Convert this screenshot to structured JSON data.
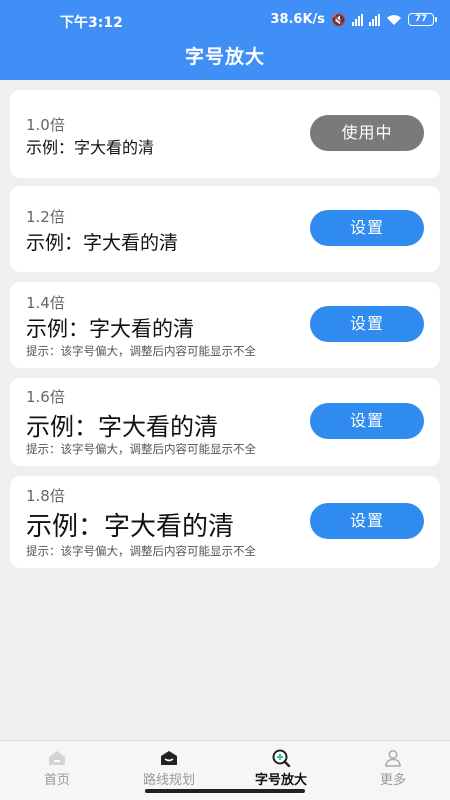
{
  "status": {
    "time": "下午3:12",
    "net_speed": "38.6K/s",
    "battery": "77"
  },
  "header": {
    "title": "字号放大"
  },
  "options": [
    {
      "scale": "1.0倍",
      "example": "示例：字大看的清",
      "hint": "",
      "button": "使用中",
      "active": true
    },
    {
      "scale": "1.2倍",
      "example": "示例：字大看的清",
      "hint": "",
      "button": "设置",
      "active": false
    },
    {
      "scale": "1.4倍",
      "example": "示例：字大看的清",
      "hint": "提示：该字号偏大，调整后内容可能显示不全",
      "button": "设置",
      "active": false
    },
    {
      "scale": "1.6倍",
      "example": "示例：字大看的清",
      "hint": "提示：该字号偏大，调整后内容可能显示不全",
      "button": "设置",
      "active": false
    },
    {
      "scale": "1.8倍",
      "example": "示例：字大看的清",
      "hint": "提示：该字号偏大，调整后内容可能显示不全",
      "button": "设置",
      "active": false
    }
  ],
  "tabbar": {
    "items": [
      {
        "label": "首页",
        "icon": "home-icon"
      },
      {
        "label": "路线规划",
        "icon": "route-icon"
      },
      {
        "label": "字号放大",
        "icon": "zoom-icon"
      },
      {
        "label": "更多",
        "icon": "user-icon"
      }
    ],
    "active_index": 2
  },
  "colors": {
    "header": "#3f8ff6",
    "button_set": "#2f8bef",
    "button_active": "#7a7a7a",
    "background": "#efefef"
  }
}
